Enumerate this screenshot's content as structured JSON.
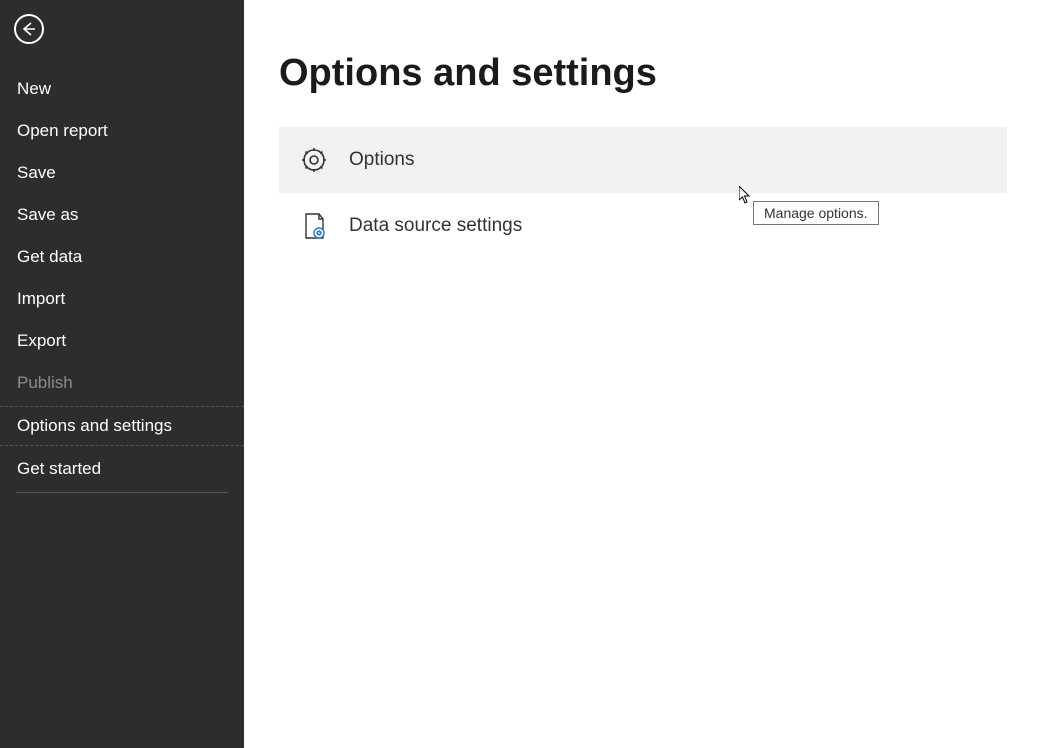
{
  "sidebar": {
    "items": [
      {
        "label": "New",
        "name": "sidebar-item-new",
        "disabled": false
      },
      {
        "label": "Open report",
        "name": "sidebar-item-open-report",
        "disabled": false
      },
      {
        "label": "Save",
        "name": "sidebar-item-save",
        "disabled": false
      },
      {
        "label": "Save as",
        "name": "sidebar-item-save-as",
        "disabled": false
      },
      {
        "label": "Get data",
        "name": "sidebar-item-get-data",
        "disabled": false
      },
      {
        "label": "Import",
        "name": "sidebar-item-import",
        "disabled": false
      },
      {
        "label": "Export",
        "name": "sidebar-item-export",
        "disabled": false
      },
      {
        "label": "Publish",
        "name": "sidebar-item-publish",
        "disabled": true
      },
      {
        "label": "Options and settings",
        "name": "sidebar-item-options-and-settings",
        "disabled": false,
        "selected": true
      },
      {
        "label": "Get started",
        "name": "sidebar-item-get-started",
        "disabled": false
      }
    ]
  },
  "main": {
    "title": "Options and settings",
    "options": [
      {
        "label": "Options",
        "name": "option-row-options",
        "icon": "gear-icon",
        "hovered": true
      },
      {
        "label": "Data source settings",
        "name": "option-row-data-source-settings",
        "icon": "data-source-icon",
        "hovered": false
      }
    ],
    "tooltip": "Manage options."
  }
}
